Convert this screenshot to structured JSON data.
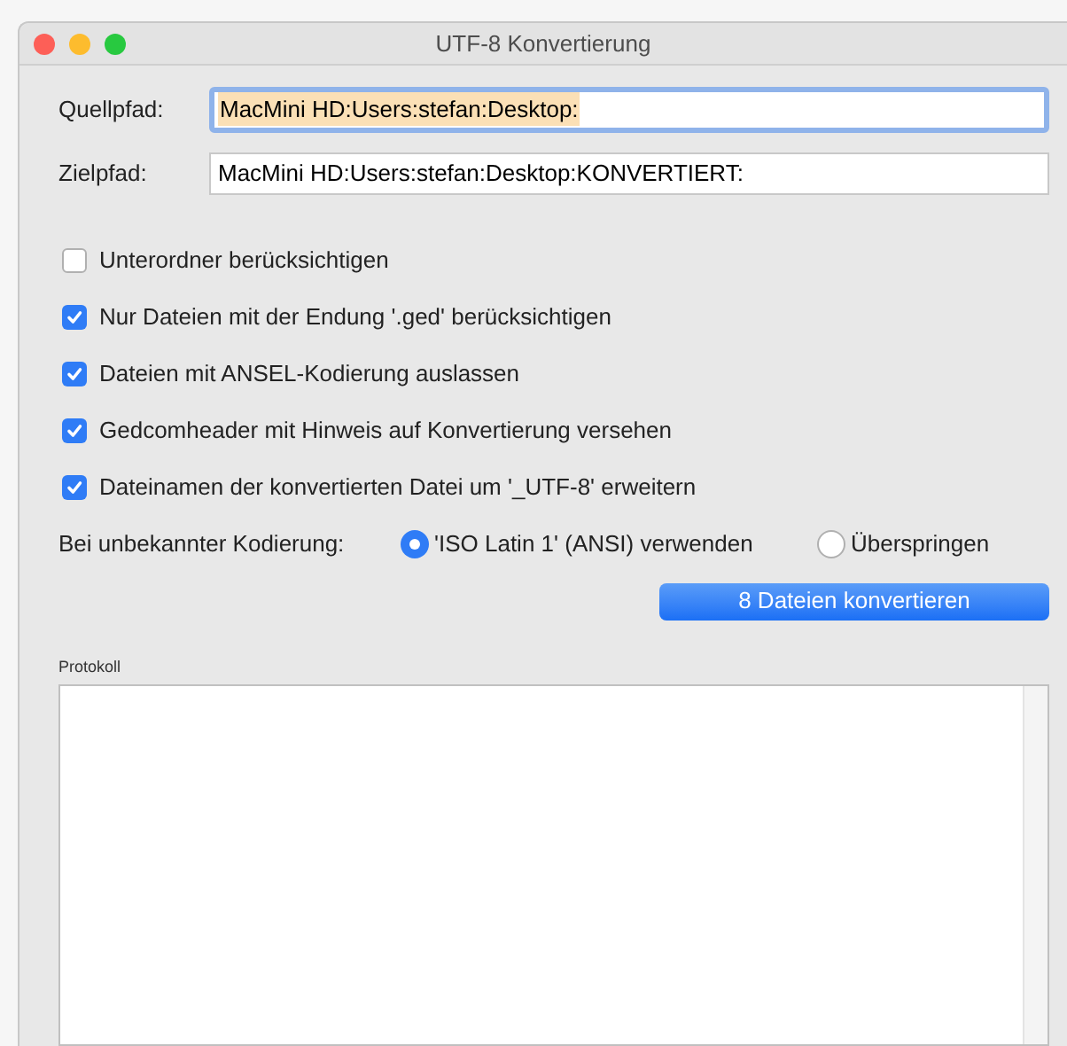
{
  "window": {
    "title": "UTF-8 Konvertierung"
  },
  "fields": [
    {
      "label": "Quellpfad:",
      "value": "MacMini HD:Users:stefan:Desktop:",
      "focused": true
    },
    {
      "label": "Zielpfad:",
      "value": "MacMini HD:Users:stefan:Desktop:KONVERTIERT:",
      "focused": false
    }
  ],
  "options": [
    {
      "label": "Unterordner berücksichtigen",
      "checked": false
    },
    {
      "label": "Nur Dateien mit der Endung '.ged' berücksichtigen",
      "checked": true
    },
    {
      "label": "Dateien mit ANSEL-Kodierung auslassen",
      "checked": true
    },
    {
      "label": "Gedcomheader mit Hinweis auf Konvertierung versehen",
      "checked": true
    },
    {
      "label": "Dateinamen der konvertierten Datei um '_UTF-8' erweitern",
      "checked": true
    }
  ],
  "unknown_encoding": {
    "label": "Bei unbekannter Kodierung:",
    "choices": [
      {
        "label": "'ISO Latin 1' (ANSI) verwenden",
        "selected": true
      },
      {
        "label": "Überspringen",
        "selected": false
      }
    ]
  },
  "convert_button": "8 Dateien konvertieren",
  "log": {
    "label": "Protokoll"
  }
}
